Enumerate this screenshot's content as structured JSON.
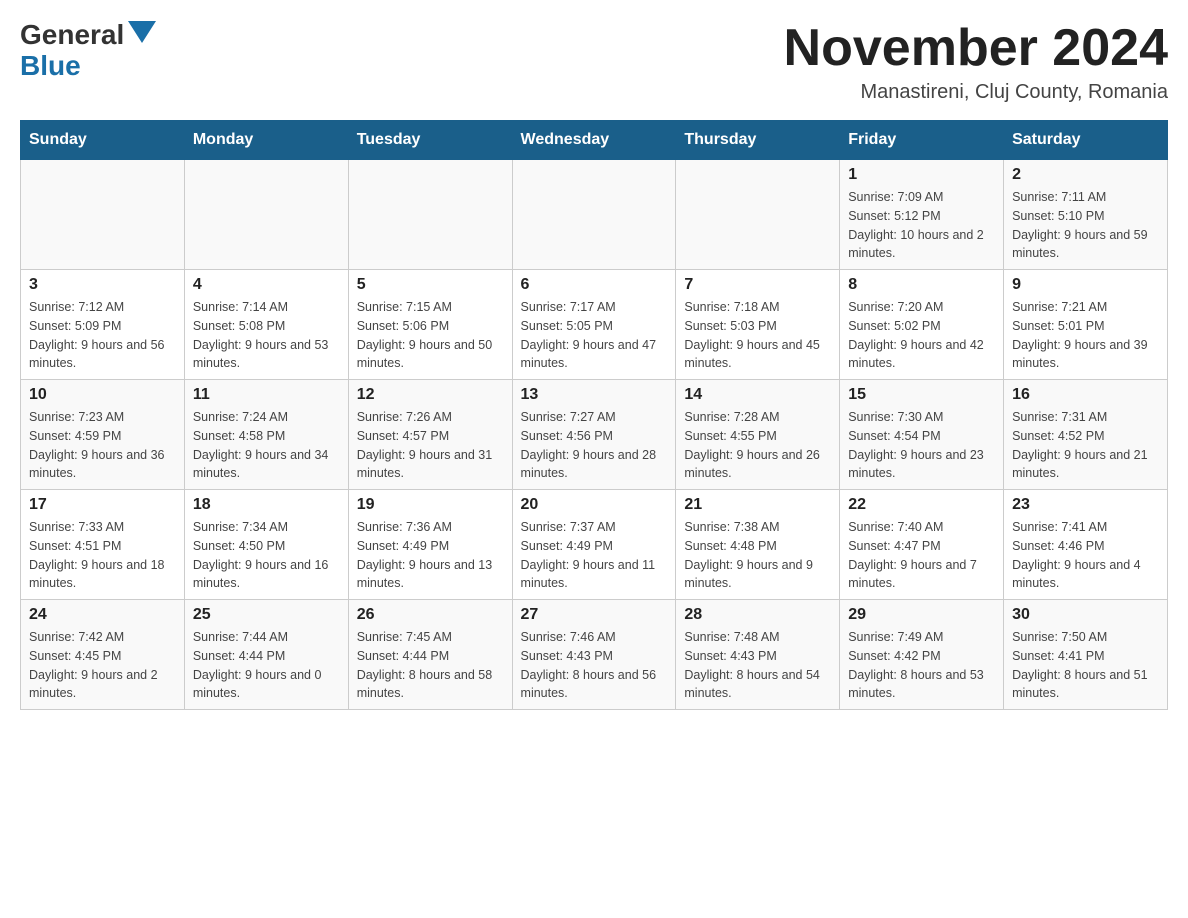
{
  "header": {
    "logo_general": "General",
    "logo_blue": "Blue",
    "month_title": "November 2024",
    "location": "Manastireni, Cluj County, Romania"
  },
  "days_of_week": [
    "Sunday",
    "Monday",
    "Tuesday",
    "Wednesday",
    "Thursday",
    "Friday",
    "Saturday"
  ],
  "weeks": [
    {
      "days": [
        {
          "number": "",
          "info": ""
        },
        {
          "number": "",
          "info": ""
        },
        {
          "number": "",
          "info": ""
        },
        {
          "number": "",
          "info": ""
        },
        {
          "number": "",
          "info": ""
        },
        {
          "number": "1",
          "info": "Sunrise: 7:09 AM\nSunset: 5:12 PM\nDaylight: 10 hours and 2 minutes."
        },
        {
          "number": "2",
          "info": "Sunrise: 7:11 AM\nSunset: 5:10 PM\nDaylight: 9 hours and 59 minutes."
        }
      ]
    },
    {
      "days": [
        {
          "number": "3",
          "info": "Sunrise: 7:12 AM\nSunset: 5:09 PM\nDaylight: 9 hours and 56 minutes."
        },
        {
          "number": "4",
          "info": "Sunrise: 7:14 AM\nSunset: 5:08 PM\nDaylight: 9 hours and 53 minutes."
        },
        {
          "number": "5",
          "info": "Sunrise: 7:15 AM\nSunset: 5:06 PM\nDaylight: 9 hours and 50 minutes."
        },
        {
          "number": "6",
          "info": "Sunrise: 7:17 AM\nSunset: 5:05 PM\nDaylight: 9 hours and 47 minutes."
        },
        {
          "number": "7",
          "info": "Sunrise: 7:18 AM\nSunset: 5:03 PM\nDaylight: 9 hours and 45 minutes."
        },
        {
          "number": "8",
          "info": "Sunrise: 7:20 AM\nSunset: 5:02 PM\nDaylight: 9 hours and 42 minutes."
        },
        {
          "number": "9",
          "info": "Sunrise: 7:21 AM\nSunset: 5:01 PM\nDaylight: 9 hours and 39 minutes."
        }
      ]
    },
    {
      "days": [
        {
          "number": "10",
          "info": "Sunrise: 7:23 AM\nSunset: 4:59 PM\nDaylight: 9 hours and 36 minutes."
        },
        {
          "number": "11",
          "info": "Sunrise: 7:24 AM\nSunset: 4:58 PM\nDaylight: 9 hours and 34 minutes."
        },
        {
          "number": "12",
          "info": "Sunrise: 7:26 AM\nSunset: 4:57 PM\nDaylight: 9 hours and 31 minutes."
        },
        {
          "number": "13",
          "info": "Sunrise: 7:27 AM\nSunset: 4:56 PM\nDaylight: 9 hours and 28 minutes."
        },
        {
          "number": "14",
          "info": "Sunrise: 7:28 AM\nSunset: 4:55 PM\nDaylight: 9 hours and 26 minutes."
        },
        {
          "number": "15",
          "info": "Sunrise: 7:30 AM\nSunset: 4:54 PM\nDaylight: 9 hours and 23 minutes."
        },
        {
          "number": "16",
          "info": "Sunrise: 7:31 AM\nSunset: 4:52 PM\nDaylight: 9 hours and 21 minutes."
        }
      ]
    },
    {
      "days": [
        {
          "number": "17",
          "info": "Sunrise: 7:33 AM\nSunset: 4:51 PM\nDaylight: 9 hours and 18 minutes."
        },
        {
          "number": "18",
          "info": "Sunrise: 7:34 AM\nSunset: 4:50 PM\nDaylight: 9 hours and 16 minutes."
        },
        {
          "number": "19",
          "info": "Sunrise: 7:36 AM\nSunset: 4:49 PM\nDaylight: 9 hours and 13 minutes."
        },
        {
          "number": "20",
          "info": "Sunrise: 7:37 AM\nSunset: 4:49 PM\nDaylight: 9 hours and 11 minutes."
        },
        {
          "number": "21",
          "info": "Sunrise: 7:38 AM\nSunset: 4:48 PM\nDaylight: 9 hours and 9 minutes."
        },
        {
          "number": "22",
          "info": "Sunrise: 7:40 AM\nSunset: 4:47 PM\nDaylight: 9 hours and 7 minutes."
        },
        {
          "number": "23",
          "info": "Sunrise: 7:41 AM\nSunset: 4:46 PM\nDaylight: 9 hours and 4 minutes."
        }
      ]
    },
    {
      "days": [
        {
          "number": "24",
          "info": "Sunrise: 7:42 AM\nSunset: 4:45 PM\nDaylight: 9 hours and 2 minutes."
        },
        {
          "number": "25",
          "info": "Sunrise: 7:44 AM\nSunset: 4:44 PM\nDaylight: 9 hours and 0 minutes."
        },
        {
          "number": "26",
          "info": "Sunrise: 7:45 AM\nSunset: 4:44 PM\nDaylight: 8 hours and 58 minutes."
        },
        {
          "number": "27",
          "info": "Sunrise: 7:46 AM\nSunset: 4:43 PM\nDaylight: 8 hours and 56 minutes."
        },
        {
          "number": "28",
          "info": "Sunrise: 7:48 AM\nSunset: 4:43 PM\nDaylight: 8 hours and 54 minutes."
        },
        {
          "number": "29",
          "info": "Sunrise: 7:49 AM\nSunset: 4:42 PM\nDaylight: 8 hours and 53 minutes."
        },
        {
          "number": "30",
          "info": "Sunrise: 7:50 AM\nSunset: 4:41 PM\nDaylight: 8 hours and 51 minutes."
        }
      ]
    }
  ]
}
